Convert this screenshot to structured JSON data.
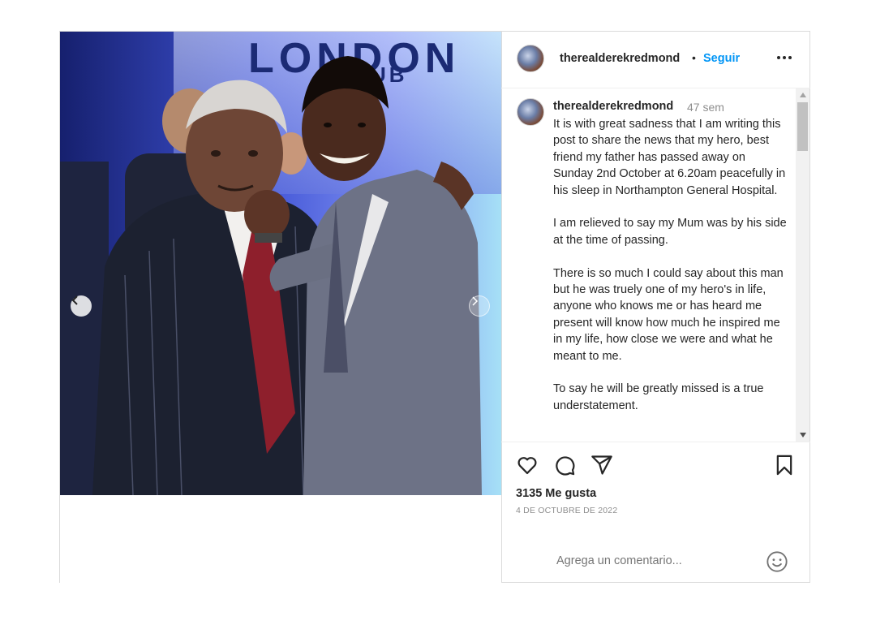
{
  "post": {
    "username": "therealderekredmond",
    "follow_label": "Seguir",
    "separator": "•",
    "caption": {
      "username": "therealderekredmond",
      "time_ago": "47 sem",
      "paragraphs": [
        "It is with great sadness that I am writing this post to share the news that my hero, best friend my father has passed away on Sunday 2nd October at 6.20am peacefully in his sleep in Northampton General Hospital.",
        "I am relieved to say my Mum was by his side at the time of passing.",
        "There is so much I could say about this man but he was truely one of my hero's in life, anyone who knows me or has heard me present will know how much he inspired me in my life, how close we were and what he meant to me.",
        "To say he will be greatly missed is a true understatement."
      ]
    },
    "likes": "3135 Me gusta",
    "date": "4 DE OCTUBRE DE 2022",
    "comment_placeholder": "Agrega un comentario...",
    "photo_sign_text": "LONDON",
    "photo_sign_subtext": "UB"
  },
  "colors": {
    "follow_blue": "#0095f6",
    "text": "#262626",
    "muted": "#8e8e8e",
    "border": "#dbdbdb"
  },
  "icons": [
    "chevron-left-icon",
    "chevron-right-icon",
    "more-icon",
    "heart-icon",
    "comment-icon",
    "share-icon",
    "bookmark-icon",
    "emoji-icon"
  ]
}
